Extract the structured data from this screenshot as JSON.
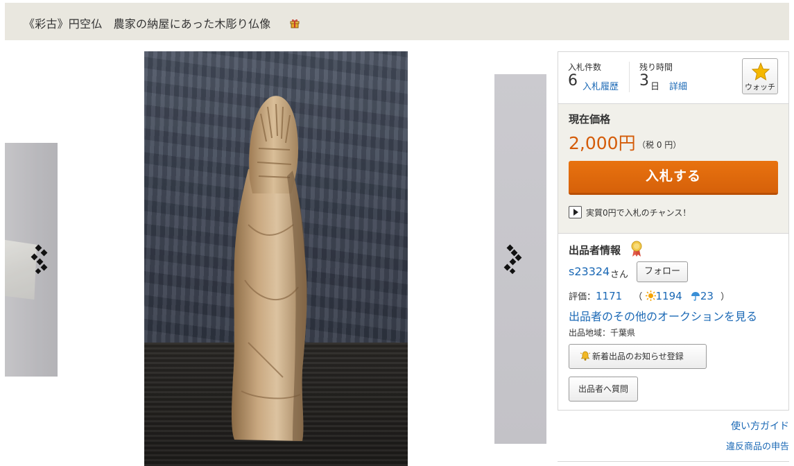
{
  "item": {
    "title": "《彩古》円空仏　農家の納屋にあった木彫り仏像",
    "title_icon": "gift-icon"
  },
  "gallery": {
    "prev_icon": "chevron-left-icon",
    "next_icon": "chevron-right-icon"
  },
  "bid_stats": {
    "bids_label": "入札件数",
    "bids_count": "6",
    "bid_history_link": "入札履歴",
    "time_label": "残り時間",
    "time_value": "3",
    "time_unit": "日",
    "details_link": "詳細",
    "watch_label": "ウォッチ",
    "watch_icon": "star-icon"
  },
  "price": {
    "label": "現在価格",
    "value": "2,000円",
    "tax": "（税 0 円）",
    "bid_button": "入札する",
    "chance_text": "実質0円で入札のチャンス！"
  },
  "seller": {
    "section_title": "出品者情報",
    "badge_icon": "medal-icon",
    "name": "s23324",
    "honorific": "さん",
    "follow_button": "フォロー",
    "rating_label": "評価：",
    "rating_total": "1171",
    "rating_good": "1194",
    "rating_bad": "23",
    "rating_open": "（",
    "rating_close": "）",
    "other_auctions_link": "出品者のその他のオークションを見る",
    "region": "出品地域：千葉県",
    "notify_button": "新着出品のお知らせ登録",
    "question_button": "出品者へ質問"
  },
  "footer": {
    "guide_link": "使い方ガイド",
    "report_link": "違反商品の申告"
  },
  "colors": {
    "accent": "#d6610a",
    "link": "#1a68b5",
    "price": "#d45b08",
    "panel_bg": "#f1f0ea"
  }
}
